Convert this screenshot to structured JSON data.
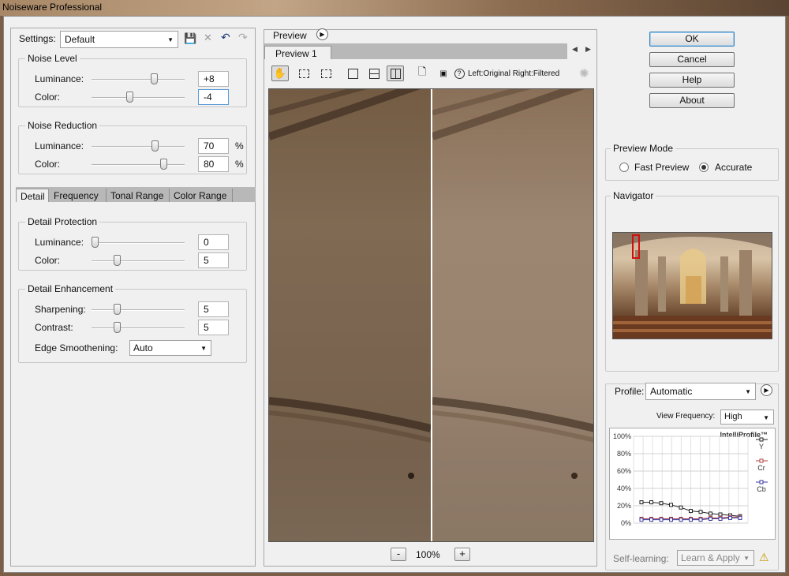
{
  "window": {
    "title": "Noiseware Professional"
  },
  "settings": {
    "label": "Settings:",
    "value": "Default"
  },
  "noise_level": {
    "title": "Noise Level",
    "rows": [
      {
        "label": "Luminance:",
        "value": "+8",
        "level": 0.69
      },
      {
        "label": "Color:",
        "value": "-4",
        "level": 0.4
      }
    ]
  },
  "noise_reduction": {
    "title": "Noise Reduction",
    "unit": "%",
    "rows": [
      {
        "label": "Luminance:",
        "value": "70",
        "level": 0.7
      },
      {
        "label": "Color:",
        "value": "80",
        "level": 0.8
      }
    ]
  },
  "tabs": [
    "Detail",
    "Frequency",
    "Tonal Range",
    "Color Range"
  ],
  "detail_protection": {
    "title": "Detail Protection",
    "rows": [
      {
        "label": "Luminance:",
        "value": "0",
        "level": 0.0
      },
      {
        "label": "Color:",
        "value": "5",
        "level": 0.26
      }
    ]
  },
  "detail_enhancement": {
    "title": "Detail Enhancement",
    "rows": [
      {
        "label": "Sharpening:",
        "value": "5",
        "level": 0.26
      },
      {
        "label": "Contrast:",
        "value": "5",
        "level": 0.26
      }
    ],
    "edge_label": "Edge Smoothening:",
    "edge_value": "Auto"
  },
  "preview": {
    "label": "Preview",
    "tab": "Preview 1",
    "compare_text": "Left:Original Right:Filtered",
    "zoom": "100%",
    "minus": "-",
    "plus": "+"
  },
  "buttons": {
    "ok": "OK",
    "cancel": "Cancel",
    "help": "Help",
    "about": "About"
  },
  "preview_mode": {
    "title": "Preview Mode",
    "fast": "Fast Preview",
    "accurate": "Accurate",
    "selected": "Accurate"
  },
  "navigator": {
    "title": "Navigator"
  },
  "profile": {
    "label": "Profile:",
    "value": "Automatic",
    "view_freq_label": "View Frequency:",
    "view_freq_value": "High"
  },
  "self_learning": {
    "label": "Self-learning:",
    "value": "Learn & Apply"
  },
  "chart_data": {
    "type": "line",
    "title": "IntelliProfile™",
    "y_ticks": [
      "0%",
      "20%",
      "40%",
      "60%",
      "80%",
      "100%"
    ],
    "ylim": [
      0,
      100
    ],
    "x": [
      1,
      2,
      3,
      4,
      5,
      6,
      7,
      8,
      9,
      10,
      11
    ],
    "series": [
      {
        "name": "Y",
        "color": "#222222",
        "values": [
          24,
          24,
          23,
          21,
          18,
          14,
          13,
          11,
          10,
          9,
          8
        ]
      },
      {
        "name": "Cr",
        "color": "#b04040",
        "values": [
          5,
          5,
          5,
          5,
          5,
          5,
          5,
          6,
          6,
          7,
          7
        ]
      },
      {
        "name": "Cb",
        "color": "#3a3aa0",
        "values": [
          4,
          4,
          4,
          4,
          4,
          4,
          4,
          5,
          5,
          6,
          6
        ]
      }
    ]
  }
}
